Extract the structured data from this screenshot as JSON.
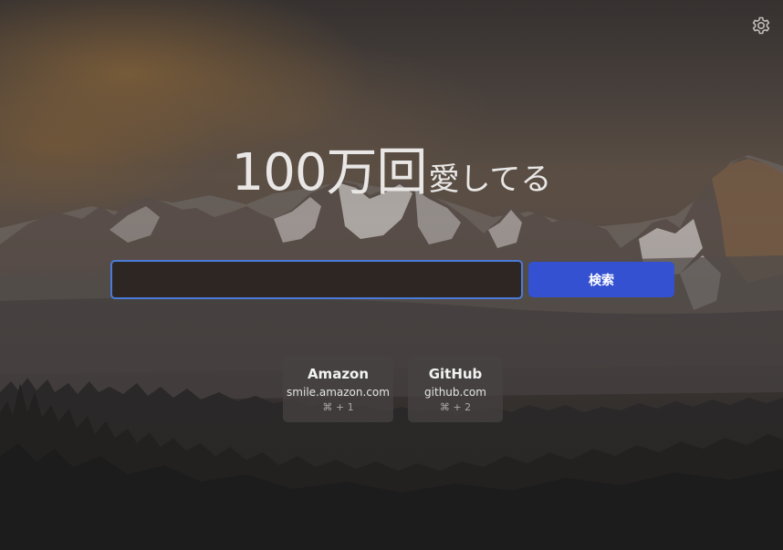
{
  "headline": {
    "big": "100万回",
    "small": "愛してる"
  },
  "search": {
    "value": "",
    "placeholder": "",
    "button_label": "検索"
  },
  "shortcuts": [
    {
      "name": "Amazon",
      "domain": "smile.amazon.com",
      "key": "⌘ + 1"
    },
    {
      "name": "GitHub",
      "domain": "github.com",
      "key": "⌘ + 2"
    }
  ],
  "settings": {
    "icon": "gear-icon"
  },
  "colors": {
    "accent_button": "#3451d1",
    "input_focus_border": "#4b7bd9",
    "text": "#e9e7e6"
  }
}
